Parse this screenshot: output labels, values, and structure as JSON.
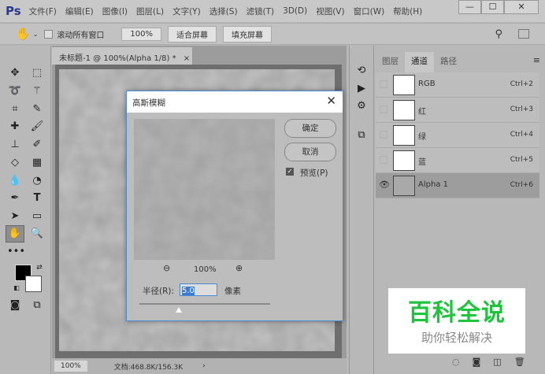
{
  "app": {
    "logo": "Ps",
    "menu": [
      "文件(F)",
      "编辑(E)",
      "图像(I)",
      "图层(L)",
      "文字(Y)",
      "选择(S)",
      "滤镜(T)",
      "3D(D)",
      "视图(V)",
      "窗口(W)",
      "帮助(H)"
    ],
    "window_controls": [
      "—",
      "☐",
      "✕"
    ]
  },
  "options": {
    "scroll_all": "滚动所有窗口",
    "zoom": "100%",
    "fit_screen": "适合屏幕",
    "fill_screen": "填充屏幕"
  },
  "document": {
    "tab_title": "未标题-1 @ 100%(Alpha 1/8) *",
    "tab_close": "×",
    "status_zoom": "100%",
    "status_doc": "文档:468.8K/156.3K",
    "status_arrow": "›"
  },
  "panel": {
    "tabs": [
      "图层",
      "通道",
      "路径"
    ],
    "active_tab": "通道",
    "channels": [
      {
        "name": "RGB",
        "shortcut": "Ctrl+2",
        "visible": false
      },
      {
        "name": "红",
        "shortcut": "Ctrl+3",
        "visible": false
      },
      {
        "name": "绿",
        "shortcut": "Ctrl+4",
        "visible": false
      },
      {
        "name": "蓝",
        "shortcut": "Ctrl+5",
        "visible": false
      },
      {
        "name": "Alpha 1",
        "shortcut": "Ctrl+6",
        "visible": true
      }
    ]
  },
  "dialog": {
    "title": "高斯模糊",
    "close": "✕",
    "ok": "确定",
    "cancel": "取消",
    "preview_label": "预览(P)",
    "preview_checked": true,
    "preview_zoom": "100%",
    "radius_label": "半径(R):",
    "radius_value": "5.0",
    "radius_unit": "像素",
    "slider_fraction": 0.3,
    "zoom_out": "−",
    "zoom_in": "+"
  },
  "watermark": {
    "title": "百科全说",
    "subtitle": "助你轻松解决",
    "color": "#1ec43c"
  }
}
